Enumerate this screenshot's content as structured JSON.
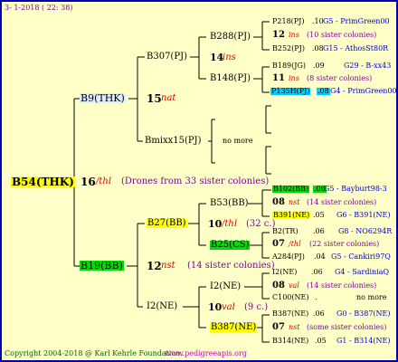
{
  "header": {
    "date": "3-  1-2018 ( 22: 38)"
  },
  "footer": {
    "copyright": "Copyright 2004-2018 @ Karl Kehrle Foundation.",
    "site": "www.pedigreeapis.org"
  },
  "root": {
    "label": "B54(THK)"
  },
  "root_info": {
    "gen": "16",
    "mark": "/thl",
    "note": "(Drones from 33 sister colonies)"
  },
  "g1": {
    "top": {
      "label": "B9(THK)",
      "gen": "15",
      "mark": "nat"
    },
    "bottom": {
      "label": "B19(BB)",
      "gen": "12",
      "mark": "nst",
      "note": "(14 sister colonies)"
    }
  },
  "g2": {
    "a": {
      "label": "B307(PJ)",
      "gen": "14",
      "mark": "ins"
    },
    "b": {
      "label": "Bmixx15(PJ)",
      "note": "no more"
    },
    "c": {
      "label": "B27(BB)",
      "gen": "10",
      "mark": "/thl",
      "note": "(32 c.)"
    },
    "d": {
      "label": "I2(NE)",
      "gen": "10",
      "mark": "val",
      "note": "(9 c.)"
    }
  },
  "g3": {
    "a": {
      "label": "B288(PJ)"
    },
    "b": {
      "label": "B148(PJ)"
    },
    "c": {
      "label": "B53(BB)"
    },
    "d": {
      "label": "B25(CS)"
    },
    "e": {
      "label": "I2(NE)"
    },
    "f": {
      "label": "B387(NE)"
    }
  },
  "g4": [
    {
      "label": "P218(PJ)",
      "year": ".10",
      "extra": "G5 - PrimGreen00"
    },
    {
      "gen": "12",
      "mark": "ins",
      "note": "(10 sister colonies)"
    },
    {
      "label": "B252(PJ)",
      "year": ".08",
      "extra": "G15 - AthosSt80R"
    },
    {
      "label": "B189(JG)",
      "year": ".09",
      "extra": "G29 - B-xx43"
    },
    {
      "gen": "11",
      "mark": "ins",
      "note": "(8 sister colonies)"
    },
    {
      "label": "P135H(PJ)",
      "year": ".08",
      "extra": "G4 - PrimGreen00"
    },
    {
      "label": "B102(BB)",
      "year": ".06",
      "extra": "G5 - Bayburt98-3"
    },
    {
      "gen": "08",
      "mark": "nst",
      "note": "(14 sister colonies)"
    },
    {
      "label": "B391(NE)",
      "year": ".05",
      "extra": "G6 - B391(NE)"
    },
    {
      "label": "B2(TR)",
      "year": ".06",
      "extra": "G8 - NO6294R"
    },
    {
      "gen": "07",
      "mark": "/thl",
      "note": "(22 sister colonies)"
    },
    {
      "label": "A284(PJ)",
      "year": ".04",
      "extra": "G5 - Cankiri97Q"
    },
    {
      "label": "I2(NE)",
      "year": ".06",
      "extra": "G4 - SardiniaQ"
    },
    {
      "gen": "08",
      "mark": "val",
      "note": "(14 sister colonies)"
    },
    {
      "label": "C100(NE)",
      "year": ".",
      "extra": "no more"
    },
    {
      "label": "B387(NE)",
      "year": ".06",
      "extra": "G0 - B387(NE)"
    },
    {
      "gen": "07",
      "mark": "nst",
      "note": "(some sister colonies)"
    },
    {
      "label": "B314(NE)",
      "year": ".05",
      "extra": "G1 - B314(NE)"
    }
  ]
}
